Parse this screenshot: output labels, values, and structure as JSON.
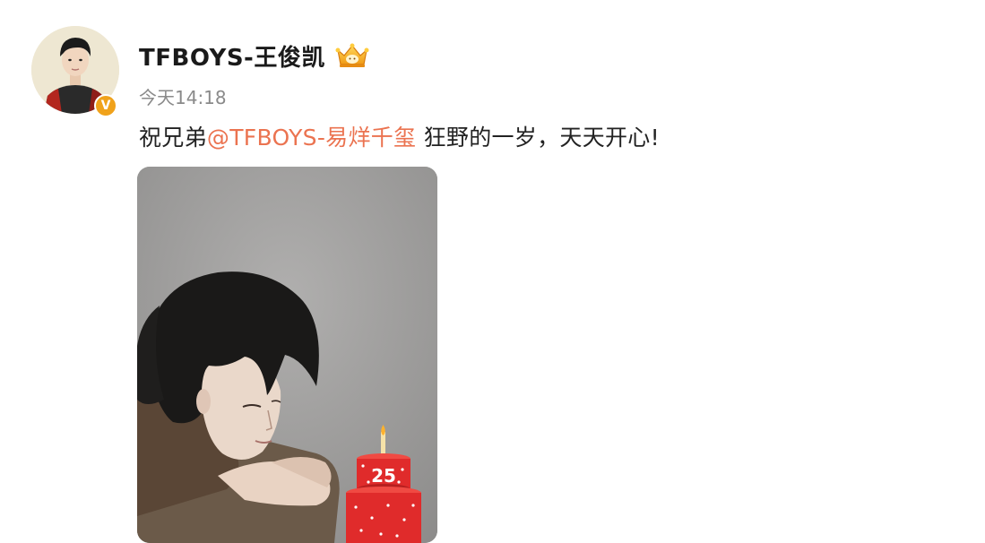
{
  "post": {
    "username": "TFBOYS-王俊凯",
    "timestamp": "今天14:18",
    "text_before": "祝兄弟",
    "mention": "@TFBOYS-易烊千玺",
    "text_after": " 狂野的一岁，天天开心!",
    "verified_mark": "V",
    "cake_number": "25"
  },
  "icons": {
    "avatar": "profile-avatar",
    "verified": "verified-badge-icon",
    "vip": "vip-crown-icon",
    "cake": "birthday-cake-icon"
  },
  "colors": {
    "mention": "#eb7350",
    "verified": "#f0a21b",
    "cake": "#e02b2b"
  }
}
